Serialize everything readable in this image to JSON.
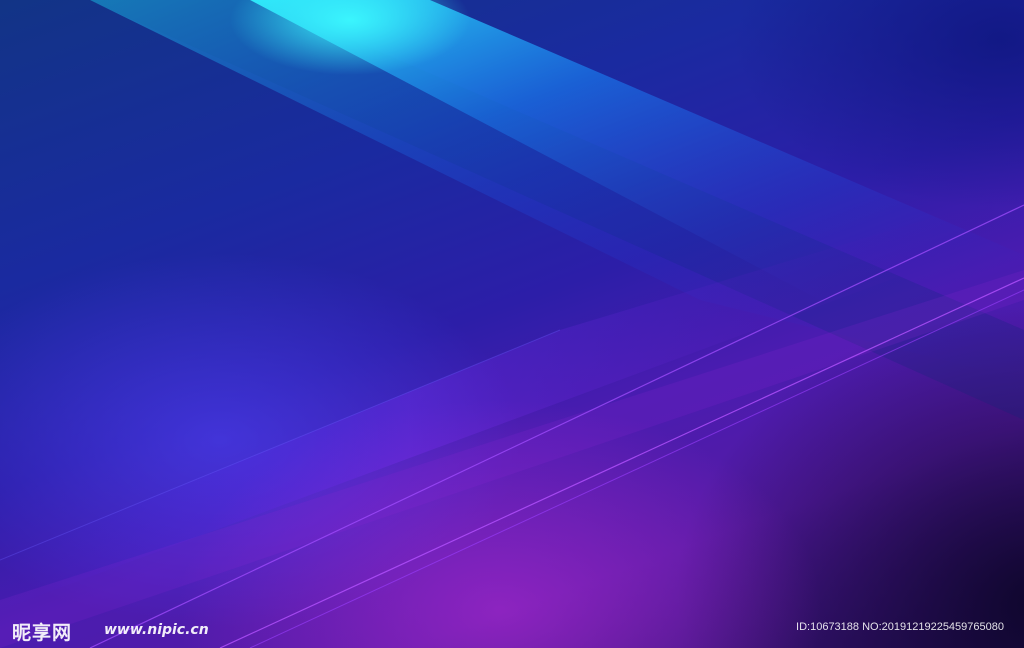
{
  "image": {
    "colors": {
      "deep_blue": "#14106b",
      "royal_blue": "#1a2aa0",
      "cyan_highlight": "#18e8ff",
      "violet": "#4a1cb0",
      "magenta_glow": "#ba2cd6",
      "dark_corner": "#080420"
    }
  },
  "watermark": {
    "logo_text": "昵享网",
    "url": "www.nipic.cn",
    "id_text": "ID:10673188 NO:20191219225459765080"
  }
}
